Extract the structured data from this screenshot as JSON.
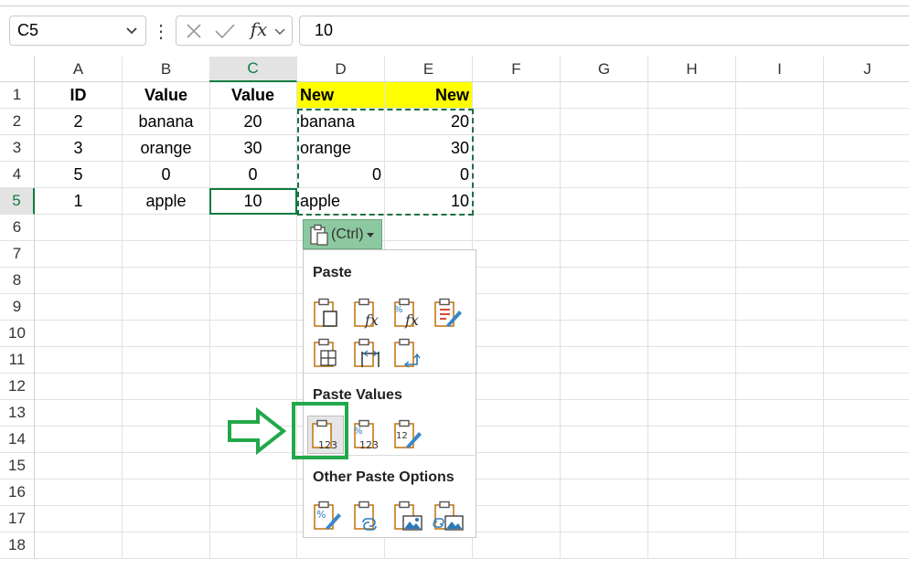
{
  "formula_bar": {
    "name_box": "C5",
    "formula": "10",
    "fx_label": "fx"
  },
  "columns": [
    "A",
    "B",
    "C",
    "D",
    "E",
    "F",
    "G",
    "H",
    "I",
    "J"
  ],
  "rows": [
    "1",
    "2",
    "3",
    "4",
    "5",
    "6",
    "7",
    "8",
    "9",
    "10",
    "11",
    "12",
    "13",
    "14",
    "15",
    "16",
    "17",
    "18"
  ],
  "cells": {
    "A1": "ID",
    "B1": "Value",
    "C1": "Value",
    "D1": "New",
    "E1": "New",
    "A2": "2",
    "B2": "banana",
    "C2": "20",
    "D2": "banana",
    "E2": "20",
    "A3": "3",
    "B3": "orange",
    "C3": "30",
    "D3": "orange",
    "E3": "30",
    "A4": "5",
    "B4": "0",
    "C4": "0",
    "D4": "0",
    "E4": "0",
    "A5": "1",
    "B5": "apple",
    "C5": "10",
    "D5": "apple",
    "E5": "10"
  },
  "selected_cell": "C5",
  "header_fill_color": "#ffff00",
  "accent_color": "#107c41",
  "highlight_color": "#22a84a",
  "paste_menu": {
    "button_label": "(Ctrl)",
    "section_paste": "Paste",
    "section_paste_values": "Paste Values",
    "section_other": "Other Paste Options",
    "paste_icons": [
      "paste-icon",
      "paste-formulas-icon",
      "paste-formulas-number-formatting-icon",
      "keep-source-formatting-icon",
      "no-borders-icon",
      "keep-column-widths-icon",
      "transpose-icon"
    ],
    "values_icons": [
      "paste-values-icon",
      "values-number-formatting-icon",
      "values-source-formatting-icon"
    ],
    "other_icons": [
      "formatting-icon",
      "paste-link-icon",
      "picture-icon",
      "linked-picture-icon"
    ],
    "values_icon_text": "123",
    "formatting_icon_text": "12"
  }
}
